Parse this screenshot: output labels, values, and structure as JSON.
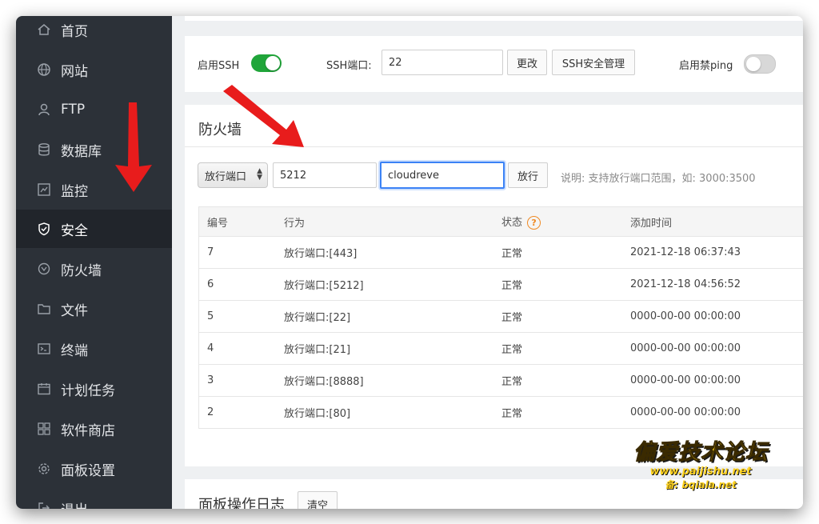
{
  "sidebar": {
    "items": [
      {
        "label": "首页",
        "icon": "home-icon"
      },
      {
        "label": "网站",
        "icon": "globe-icon"
      },
      {
        "label": "FTP",
        "icon": "ftp-icon"
      },
      {
        "label": "数据库",
        "icon": "database-icon"
      },
      {
        "label": "监控",
        "icon": "monitor-icon"
      },
      {
        "label": "安全",
        "icon": "shield-icon",
        "active": true
      },
      {
        "label": "防火墙",
        "icon": "firewall-icon"
      },
      {
        "label": "文件",
        "icon": "folder-icon"
      },
      {
        "label": "终端",
        "icon": "terminal-icon"
      },
      {
        "label": "计划任务",
        "icon": "calendar-icon"
      },
      {
        "label": "软件商店",
        "icon": "apps-icon"
      },
      {
        "label": "面板设置",
        "icon": "gear-icon"
      },
      {
        "label": "退出",
        "icon": "logout-icon"
      }
    ]
  },
  "ssh": {
    "enable_label": "启用SSH",
    "enabled": true,
    "port_label": "SSH端口:",
    "port_value": "22",
    "change_button": "更改",
    "manage_button": "SSH安全管理",
    "ping_label": "启用禁ping",
    "ping_enabled": false
  },
  "firewall": {
    "title": "防火墙",
    "action_select": "放行端口",
    "port_input": "5212",
    "note_input": "cloudreve",
    "allow_button": "放行",
    "hint": "说明: 支持放行端口范围，如: 3000:3500",
    "columns": {
      "id": "编号",
      "action": "行为",
      "status": "状态",
      "time": "添加时间"
    },
    "rows": [
      {
        "id": "7",
        "action": "放行端口:[443]",
        "status": "正常",
        "time": "2021-12-18 06:37:43"
      },
      {
        "id": "6",
        "action": "放行端口:[5212]",
        "status": "正常",
        "time": "2021-12-18 04:56:52"
      },
      {
        "id": "5",
        "action": "放行端口:[22]",
        "status": "正常",
        "time": "0000-00-00 00:00:00"
      },
      {
        "id": "4",
        "action": "放行端口:[21]",
        "status": "正常",
        "time": "0000-00-00 00:00:00"
      },
      {
        "id": "3",
        "action": "放行端口:[8888]",
        "status": "正常",
        "time": "0000-00-00 00:00:00"
      },
      {
        "id": "2",
        "action": "放行端口:[80]",
        "status": "正常",
        "time": "0000-00-00 00:00:00"
      }
    ]
  },
  "log": {
    "title": "面板操作日志",
    "clear_button": "清空"
  },
  "watermark": {
    "title": "偏爱技术论坛",
    "url": "www.paijishu.net",
    "backup": "备: bqiala.net"
  },
  "colors": {
    "sidebar_bg": "#2c3138",
    "accent_green": "#20a53a",
    "arrow_red": "#e81c1c",
    "focus_blue": "#3b82f6",
    "help_orange": "#f08a24",
    "watermark_yellow": "#ffd21f"
  }
}
